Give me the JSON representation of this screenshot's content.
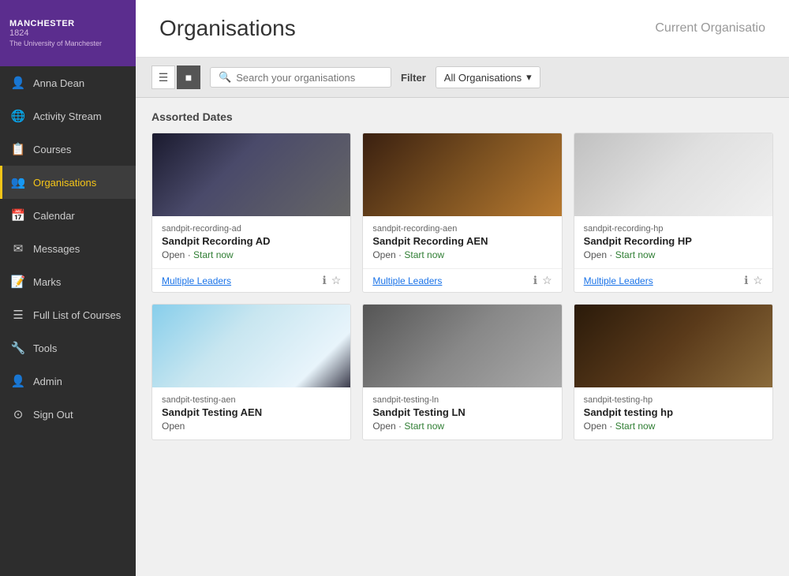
{
  "logo": {
    "top": "MANCHESTER",
    "year": "1824",
    "subtitle": "The University of Manchester"
  },
  "sidebar": {
    "user": "Anna Dean",
    "items": [
      {
        "id": "user",
        "label": "Anna Dean",
        "icon": "👤"
      },
      {
        "id": "activity",
        "label": "Activity Stream",
        "icon": "🌐"
      },
      {
        "id": "courses",
        "label": "Courses",
        "icon": "📋"
      },
      {
        "id": "organisations",
        "label": "Organisations",
        "icon": "👥",
        "active": true
      },
      {
        "id": "calendar",
        "label": "Calendar",
        "icon": "📅"
      },
      {
        "id": "messages",
        "label": "Messages",
        "icon": "✉"
      },
      {
        "id": "marks",
        "label": "Marks",
        "icon": "📝"
      },
      {
        "id": "fulllist",
        "label": "Full List of Courses",
        "icon": "☰"
      },
      {
        "id": "tools",
        "label": "Tools",
        "icon": "🔧"
      },
      {
        "id": "admin",
        "label": "Admin",
        "icon": "👤"
      },
      {
        "id": "signout",
        "label": "Sign Out",
        "icon": "⊙"
      }
    ]
  },
  "header": {
    "title": "Organisations",
    "current_org_label": "Current Organisatio"
  },
  "toolbar": {
    "search_placeholder": "Search your organisations",
    "filter_label": "Filter",
    "filter_value": "All Organisations"
  },
  "content": {
    "section_title": "Assorted Dates",
    "cards": [
      {
        "id": "sandpit-recording-ad",
        "code": "sandpit-recording-ad",
        "name": "Sandpit Recording AD",
        "status": "Open",
        "start_now": true,
        "leaders": "Multiple Leaders",
        "img_class": "img-ad"
      },
      {
        "id": "sandpit-recording-aen",
        "code": "sandpit-recording-aen",
        "name": "Sandpit Recording AEN",
        "status": "Open",
        "start_now": true,
        "leaders": "Multiple Leaders",
        "img_class": "img-aen"
      },
      {
        "id": "sandpit-recording-hp",
        "code": "sandpit-recording-hp",
        "name": "Sandpit Recording HP",
        "status": "Open",
        "start_now": true,
        "leaders": "Multiple Leaders",
        "img_class": "img-hp"
      },
      {
        "id": "sandpit-testing-aen",
        "code": "sandpit-testing-aen",
        "name": "Sandpit Testing AEN",
        "status": "Open",
        "start_now": false,
        "leaders": null,
        "img_class": "img-testing-aen"
      },
      {
        "id": "sandpit-testing-ln",
        "code": "sandpit-testing-ln",
        "name": "Sandpit Testing LN",
        "status": "Open",
        "start_now": true,
        "leaders": null,
        "img_class": "img-testing-ln"
      },
      {
        "id": "sandpit-testing-hp",
        "code": "sandpit-testing-hp",
        "name": "Sandpit testing hp",
        "status": "Open",
        "start_now": true,
        "leaders": null,
        "img_class": "img-testing-hp"
      }
    ],
    "start_now_label": "Start now",
    "multiple_leaders_label": "Multiple Leaders"
  }
}
